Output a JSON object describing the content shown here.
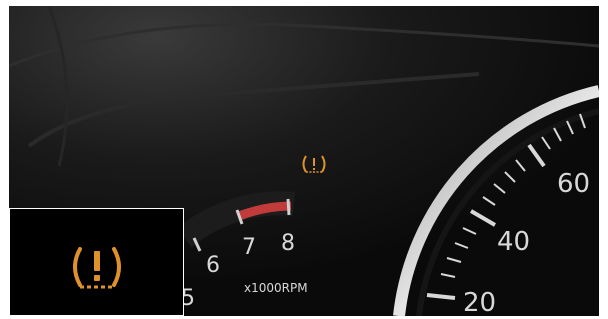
{
  "tachometer": {
    "labels": [
      "5",
      "6",
      "7",
      "8"
    ],
    "unit": "x1000RPM",
    "redline_color": "#c23b3b"
  },
  "speedometer": {
    "labels": [
      "20",
      "40",
      "60"
    ]
  },
  "warning_light": {
    "icon": "tire-pressure-warning-icon",
    "color": "#e0922a"
  },
  "inset": {
    "icon": "tire-pressure-warning-icon",
    "color": "#e0922a"
  }
}
